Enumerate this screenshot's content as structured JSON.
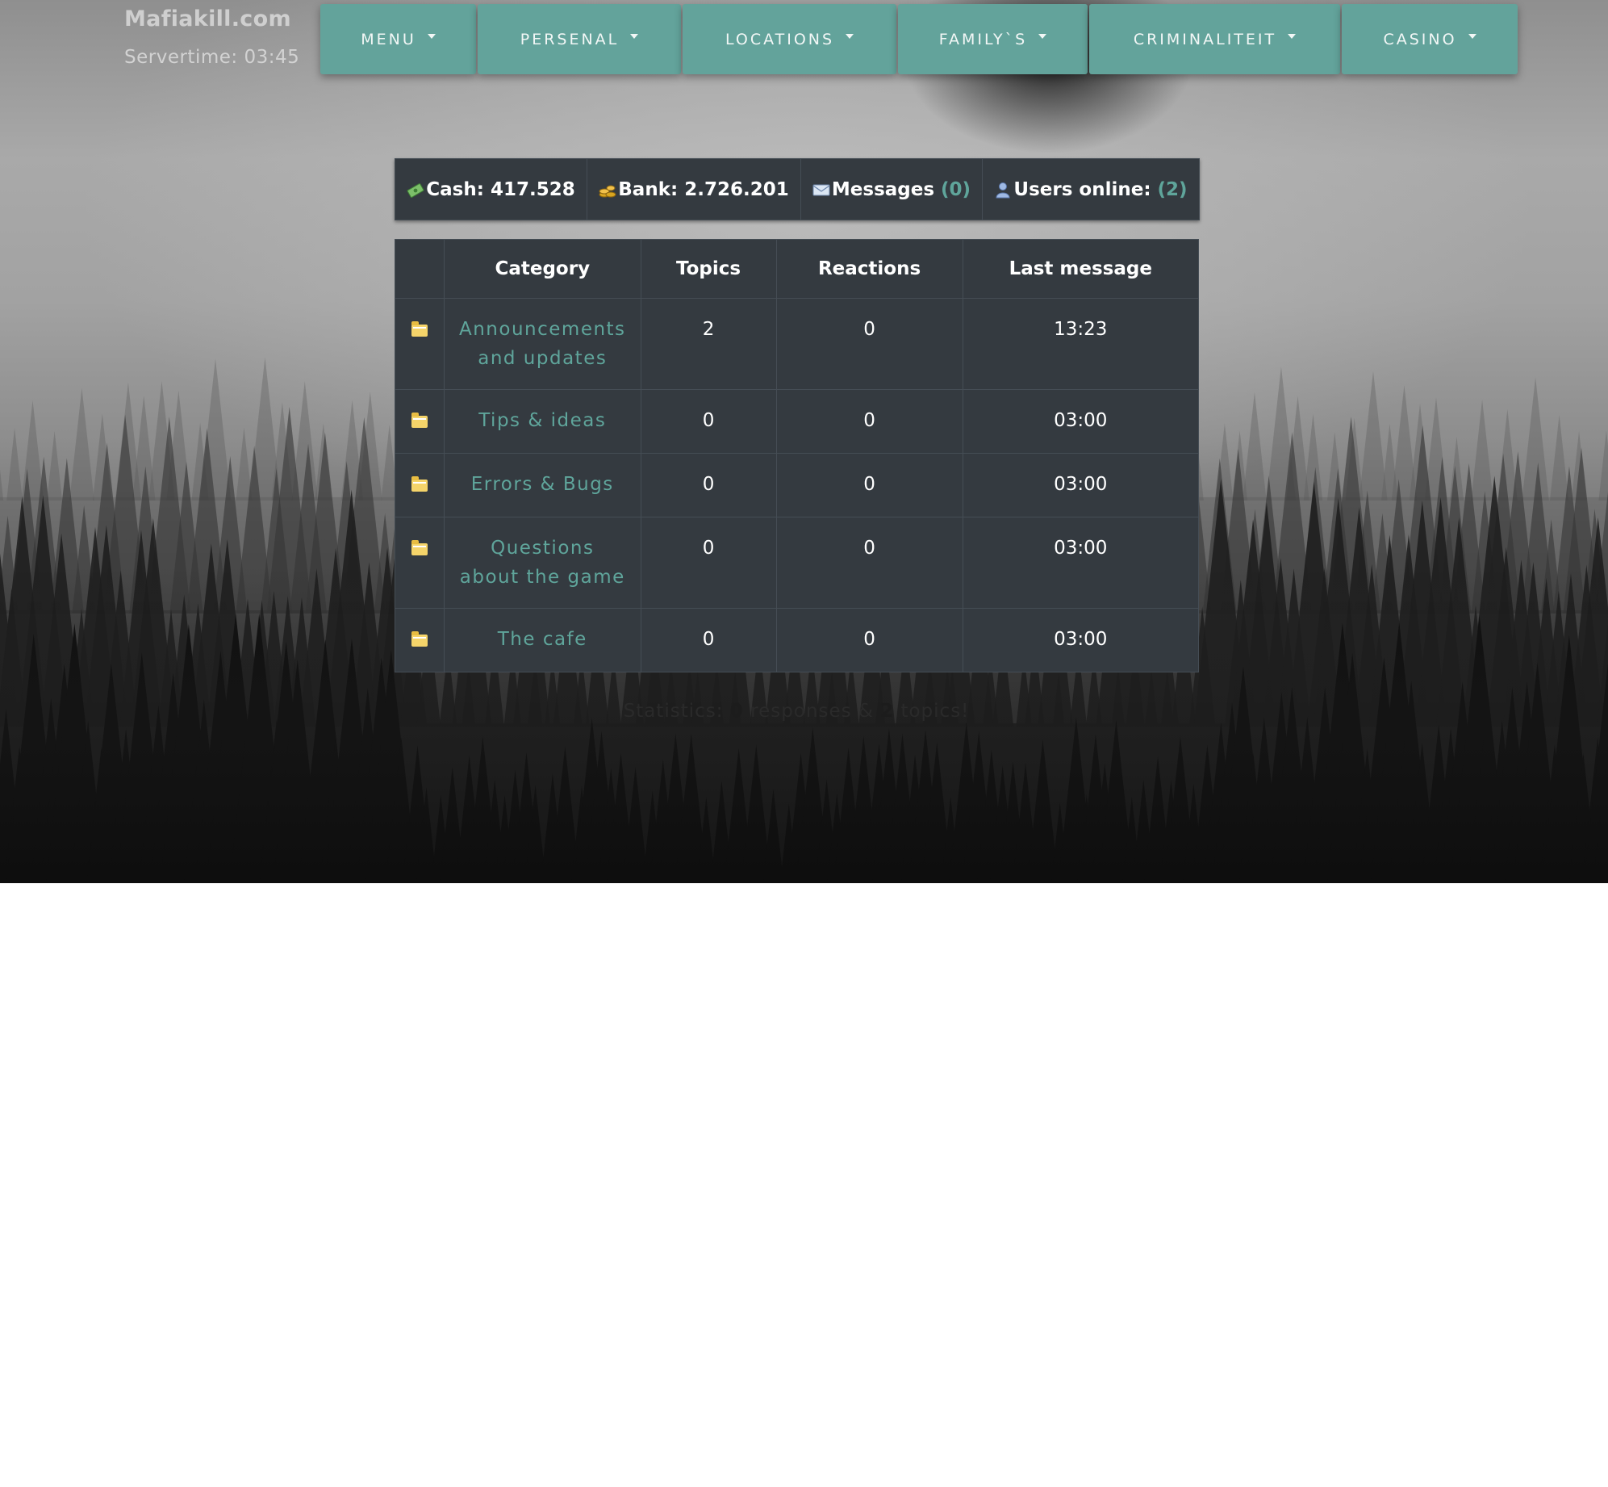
{
  "brand": "Mafiakill.com",
  "servertime": "Servertime: 03:45",
  "nav": [
    {
      "label": "MENU"
    },
    {
      "label": "PERSENAL"
    },
    {
      "label": "LOCATIONS"
    },
    {
      "label": "FAMILY`S"
    },
    {
      "label": "CRIMINALITEIT"
    },
    {
      "label": "CASINO"
    }
  ],
  "stats": {
    "cash_label": "Cash:",
    "cash_value": "417.528",
    "bank_label": "Bank:",
    "bank_value": "2.726.201",
    "messages_label": "Messages",
    "messages_count": "(0)",
    "users_label": "Users online:",
    "users_count": "(2)"
  },
  "table": {
    "headers": [
      "",
      "Category",
      "Topics",
      "Reactions",
      "Last message"
    ],
    "rows": [
      {
        "category": "Announcements and updates",
        "topics": "2",
        "reactions": "0",
        "last": "13:23"
      },
      {
        "category": "Tips & ideas",
        "topics": "0",
        "reactions": "0",
        "last": "03:00"
      },
      {
        "category": "Errors & Bugs",
        "topics": "0",
        "reactions": "0",
        "last": "03:00"
      },
      {
        "category": "Questions about the game",
        "topics": "0",
        "reactions": "0",
        "last": "03:00"
      },
      {
        "category": "The cafe",
        "topics": "0",
        "reactions": "0",
        "last": "03:00"
      }
    ]
  },
  "statistics": {
    "prefix": "Statistics:",
    "responses": "0",
    "middle": "responses &",
    "topics": "2",
    "suffix": "topics!"
  }
}
